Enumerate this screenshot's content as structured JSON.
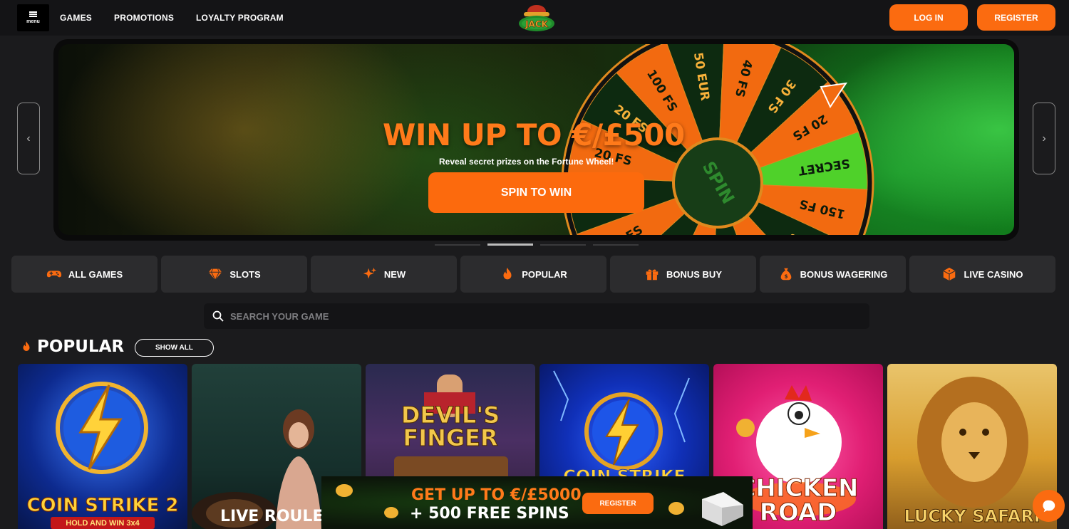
{
  "header": {
    "menu_label": "menu",
    "nav": [
      "GAMES",
      "PROMOTIONS",
      "LOYALTY PROGRAM"
    ],
    "login_label": "LOG IN",
    "register_label": "REGISTER"
  },
  "hero": {
    "title": "WIN UP TO €/£500",
    "subtitle": "Reveal secret prizes on the Fortune Wheel!",
    "cta_label": "SPIN TO WIN",
    "wheel_center": "SPIN",
    "wheel_segments": [
      "20 FS",
      "100 FS",
      "50 EUR",
      "40 FS",
      "30 FS",
      "20 FS",
      "SECRET",
      "150 FS",
      "30 FS",
      "50 EUR"
    ],
    "prev_icon": "chevron-left-icon",
    "next_icon": "chevron-right-icon"
  },
  "categories": [
    {
      "label": "ALL GAMES",
      "icon": "gamepad-icon"
    },
    {
      "label": "SLOTS",
      "icon": "diamond-icon"
    },
    {
      "label": "NEW",
      "icon": "sparkle-icon"
    },
    {
      "label": "POPULAR",
      "icon": "flame-icon"
    },
    {
      "label": "BONUS BUY",
      "icon": "gift-icon"
    },
    {
      "label": "BONUS WAGERING",
      "icon": "money-bag-icon"
    },
    {
      "label": "LIVE CASINO",
      "icon": "dice-icon"
    }
  ],
  "search": {
    "placeholder": "SEARCH YOUR GAME"
  },
  "popular": {
    "title": "POPULAR",
    "show_all_label": "SHOW ALL",
    "games": [
      {
        "name": "COIN STRIKE 2",
        "sub": "HOLD AND WIN 3x4"
      },
      {
        "name": "LIVE ROULETTE",
        "sub": ""
      },
      {
        "name": "DEVIL'S FINGER",
        "sub": ""
      },
      {
        "name": "COIN STRIKE",
        "sub": ""
      },
      {
        "name": "CHICKEN ROAD",
        "sub": ""
      },
      {
        "name": "LUCKY SAFARI",
        "sub": ""
      }
    ]
  },
  "promo": {
    "line1": "GET UP TO €/£5000",
    "line2": "+ 500 FREE SPINS",
    "button_label": "REGISTER"
  },
  "colors": {
    "accent": "#fb6b10",
    "bg": "#1b1b1d",
    "card": "#2c2c2e"
  }
}
